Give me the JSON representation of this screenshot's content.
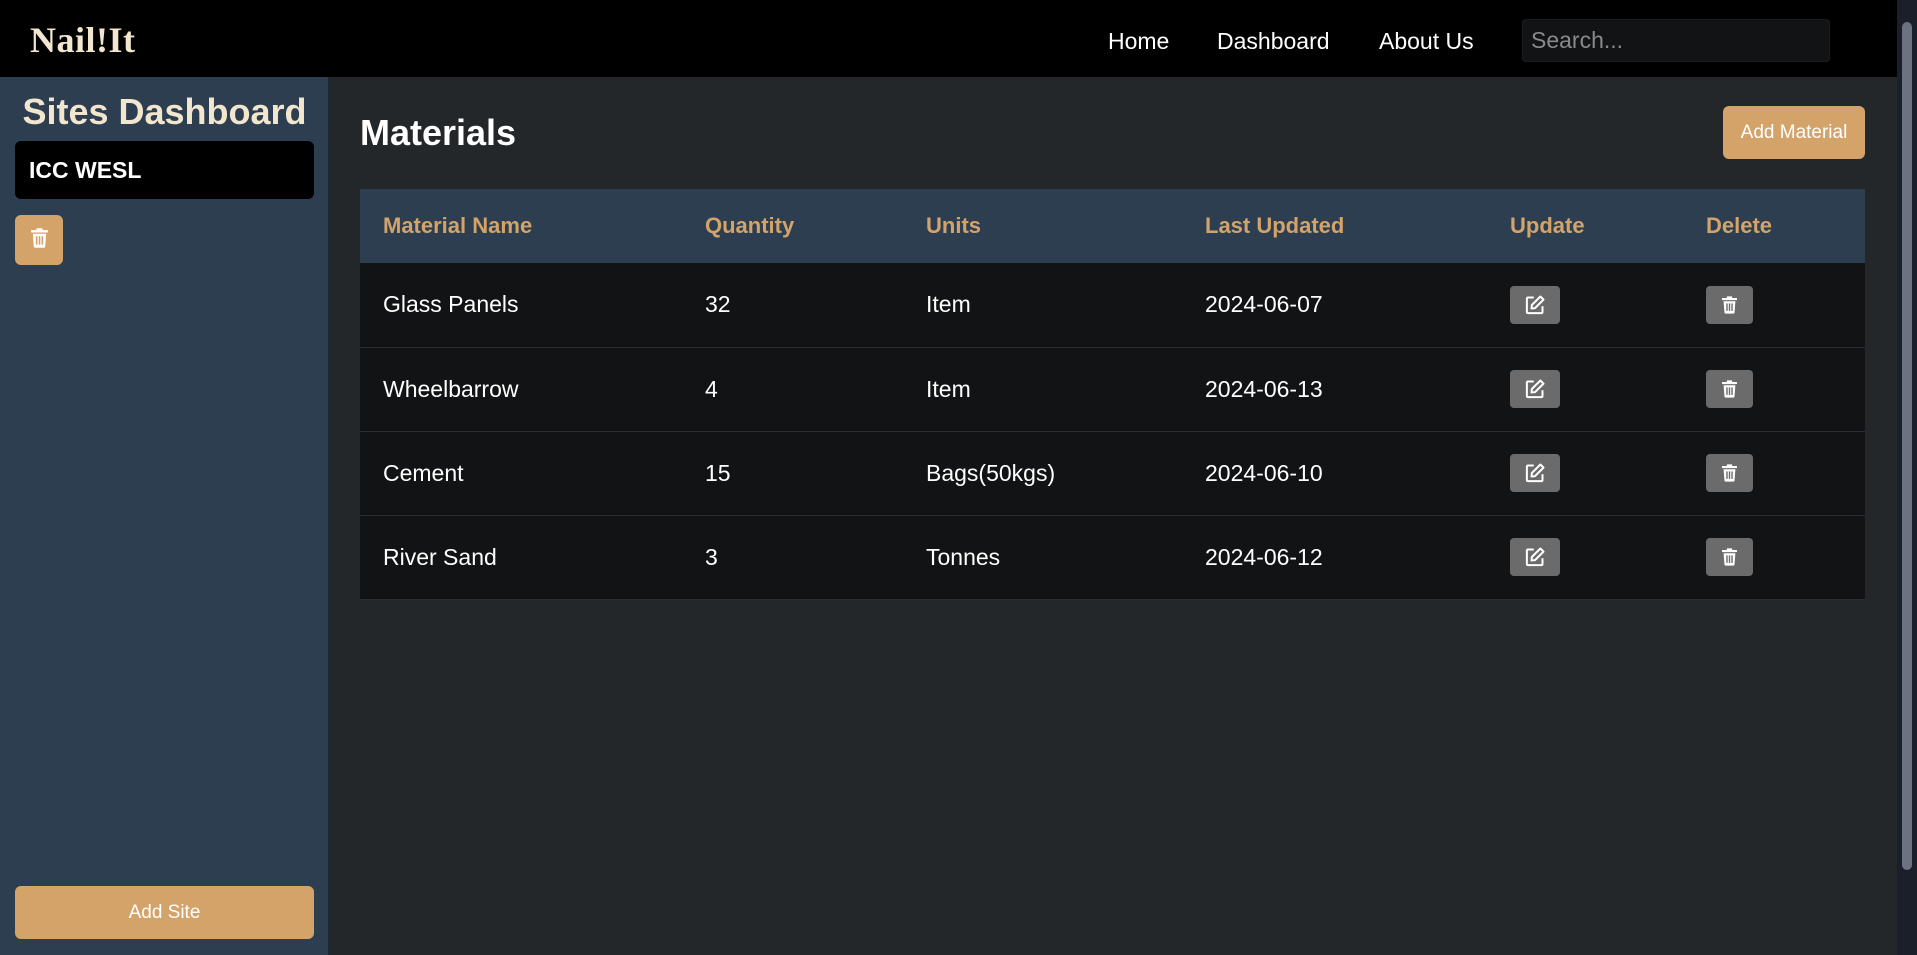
{
  "navbar": {
    "logo": "Nail!It",
    "links": {
      "home": "Home",
      "dashboard": "Dashboard",
      "about": "About Us"
    },
    "search_placeholder": "Search..."
  },
  "sidebar": {
    "title": "Sites Dashboard",
    "sites": [
      {
        "label": "ICC WESL"
      }
    ],
    "add_site_label": "Add Site"
  },
  "main": {
    "title": "Materials",
    "add_material_label": "Add Material",
    "table": {
      "headers": [
        "Material Name",
        "Quantity",
        "Units",
        "Last Updated",
        "Update",
        "Delete"
      ],
      "rows": [
        {
          "name": "Glass Panels",
          "quantity": "32",
          "units": "Item",
          "last_updated": "2024-06-07"
        },
        {
          "name": "Wheelbarrow",
          "quantity": "4",
          "units": "Item",
          "last_updated": "2024-06-13"
        },
        {
          "name": "Cement",
          "quantity": "15",
          "units": "Bags(50kgs)",
          "last_updated": "2024-06-10"
        },
        {
          "name": "River Sand",
          "quantity": "3",
          "units": "Tonnes",
          "last_updated": "2024-06-12"
        }
      ]
    }
  },
  "icons": {
    "edit": "edit-icon",
    "delete": "trash-icon"
  },
  "colors": {
    "accent": "#d4a36a",
    "navbar_bg": "#000000",
    "sidebar_bg": "#2c3e50",
    "main_bg": "#232729",
    "icon_button_bg": "#6b6b6b"
  }
}
